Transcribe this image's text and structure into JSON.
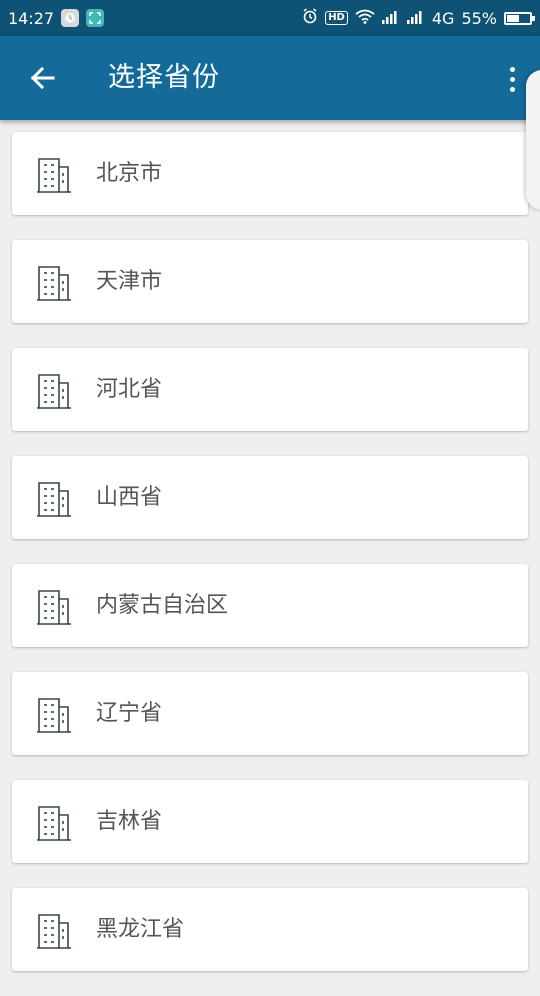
{
  "status_bar": {
    "time": "14:27",
    "hd": "HD",
    "network": "4G",
    "battery_percent": "55%",
    "battery_level": 0.55
  },
  "toolbar": {
    "title": "选择省份",
    "back_icon": "arrow-back-icon",
    "menu_icon": "more-vert-icon"
  },
  "provinces": [
    {
      "name": "北京市",
      "icon": "building-icon"
    },
    {
      "name": "天津市",
      "icon": "building-icon"
    },
    {
      "name": "河北省",
      "icon": "building-icon"
    },
    {
      "name": "山西省",
      "icon": "building-icon"
    },
    {
      "name": "内蒙古自治区",
      "icon": "building-icon"
    },
    {
      "name": "辽宁省",
      "icon": "building-icon"
    },
    {
      "name": "吉林省",
      "icon": "building-icon"
    },
    {
      "name": "黑龙江省",
      "icon": "building-icon"
    }
  ],
  "colors": {
    "status_bar": "#0e5276",
    "toolbar": "#146b9a",
    "background": "#efefef",
    "icon": "#37474f"
  }
}
